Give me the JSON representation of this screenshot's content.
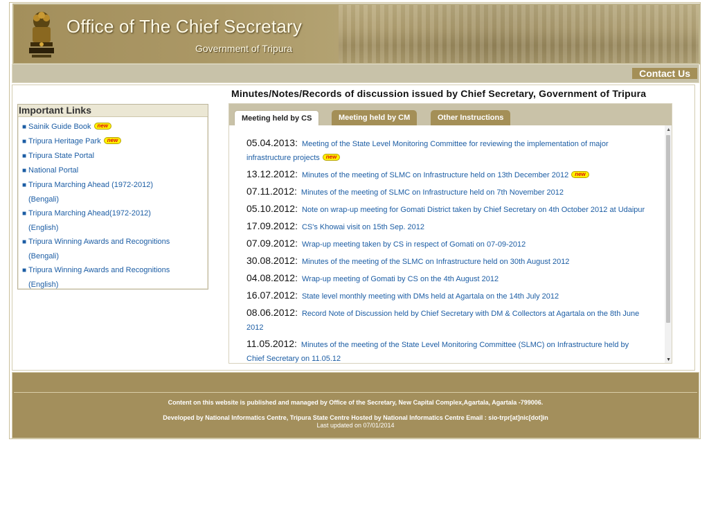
{
  "header": {
    "title": "Office of The Chief Secretary",
    "subtitle": "Government of Tripura"
  },
  "nav": {
    "contact_label": "Contact Us"
  },
  "page": {
    "heading": "Minutes/Notes/Records of discussion issued by Chief Secretary, Government of Tripura"
  },
  "sidebar": {
    "heading": "Important Links",
    "items": [
      {
        "line1": "Sainik Guide Book",
        "line2": "",
        "badge": "new"
      },
      {
        "line1": "Tripura Heritage Park",
        "line2": "",
        "badge": "new"
      },
      {
        "line1": "Tripura State Portal",
        "line2": "",
        "badge": ""
      },
      {
        "line1": "National Portal",
        "line2": "",
        "badge": ""
      },
      {
        "line1": "Tripura Marching Ahead (1972-2012)",
        "line2": "(Bengali)",
        "badge": ""
      },
      {
        "line1": "Tripura Marching Ahead(1972-2012)",
        "line2": "(English)",
        "badge": ""
      },
      {
        "line1": "Tripura Winning Awards and Recognitions",
        "line2": "(Bengali)",
        "badge": ""
      },
      {
        "line1": "Tripura Winning Awards and Recognitions",
        "line2": "(English)",
        "badge": ""
      }
    ]
  },
  "tabs": [
    {
      "label": "Meeting held by CS",
      "active": true
    },
    {
      "label": "Meeting held by CM",
      "active": false
    },
    {
      "label": "Other Instructions",
      "active": false
    }
  ],
  "entries": [
    {
      "date": "05.04.2013",
      "sep": ":",
      "text": "Meeting of the State Level Monitoring Committee for reviewing the implementation of major infrastructure projects",
      "badge": "new"
    },
    {
      "date": "13.12.2012",
      "sep": ":",
      "text": "Minutes of the meeting of SLMC on Infrastructure held on 13th December 2012",
      "badge": "new"
    },
    {
      "date": "07.11.2012",
      "sep": ":",
      "text": "Minutes of the meeting of SLMC on Infrastructure held on 7th November 2012",
      "badge": ""
    },
    {
      "date": "05.10.2012",
      "sep": ":",
      "text": "Note on wrap-up meeting for Gomati District taken by Chief Secretary on 4th October 2012 at Udaipur",
      "badge": ""
    },
    {
      "date": "17.09.2012",
      "sep": ":",
      "text": "CS's Khowai visit on 15th Sep. 2012",
      "badge": ""
    },
    {
      "date": "07.09.2012",
      "sep": ":",
      "text": "Wrap-up meeting taken by CS in respect of Gomati on 07-09-2012",
      "badge": ""
    },
    {
      "date": "30.08.2012",
      "sep": ":",
      "text": "Minutes of the meeting of the SLMC on Infrastructure held on 30th August 2012",
      "badge": ""
    },
    {
      "date": "04.08.2012",
      "sep": ":",
      "text": "Wrap-up meeting of Gomati by CS on the 4th August 2012",
      "badge": ""
    },
    {
      "date": "16.07.2012",
      "sep": ":",
      "text": "State level monthly meeting with DMs held at Agartala on the 14th July 2012",
      "badge": ""
    },
    {
      "date": "08.06.2012",
      "sep": ":",
      "text": "Record Note of Discussion held by Chief Secretary with DM & Collectors at Agartala on the 8th June 2012",
      "badge": ""
    },
    {
      "date": "11.05.2012",
      "sep": ":",
      "text": "Minutes of the meeting of the State Level Monitoring Committee (SLMC) on Infrastructure held by Chief Secretary on 11.05.12",
      "badge": ""
    }
  ],
  "footer": {
    "line1": "Content on this website is published and managed by Office of the Secretary, New Capital Complex,Agartala, Agartala -799006.",
    "line2": "Developed by National Informatics Centre, Tripura State Centre Hosted by National Informatics Centre Email : sio-trpr[at]nic[dot]in",
    "line3": "Last updated on 07/01/2014"
  },
  "colors": {
    "brand": "#a38f5c",
    "link": "#1c5da4",
    "navbar": "#c8c2a9"
  },
  "icons": {
    "emblem": "state-emblem-icon",
    "bullet": "square-bullet-icon",
    "new": "new-badge-icon"
  }
}
